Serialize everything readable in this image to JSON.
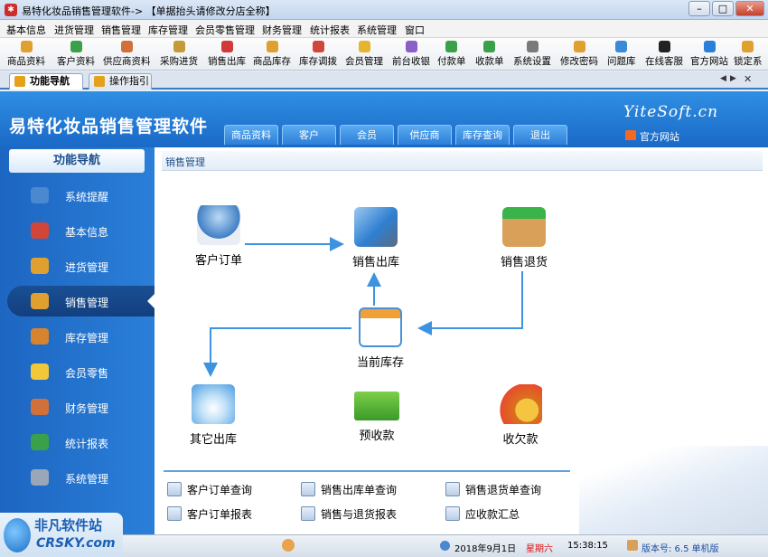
{
  "window": {
    "title": "易特化妆品销售管理软件-> 【单据抬头请修改分店全称】",
    "controls": {
      "minimize": "–",
      "maximize": "□",
      "close": "✕"
    }
  },
  "menu": [
    "基本信息",
    "进货管理",
    "销售管理",
    "库存管理",
    "会员零售管理",
    "财务管理",
    "统计报表",
    "系统管理",
    "窗口"
  ],
  "toolbar": [
    {
      "label": "商品资料",
      "icon": "goods-icon",
      "color": "#e0a030"
    },
    {
      "label": "客户资料",
      "icon": "customer-icon",
      "color": "#3aa14a"
    },
    {
      "label": "供应商资料",
      "icon": "supplier-icon",
      "color": "#d2703a"
    },
    {
      "label": "采购进货",
      "icon": "purchase-icon",
      "color": "#c59b3a"
    },
    {
      "label": "销售出库",
      "icon": "sales-out-icon",
      "color": "#d23a3a"
    },
    {
      "label": "商品库存",
      "icon": "inventory-icon",
      "color": "#e0a030"
    },
    {
      "label": "库存调拨",
      "icon": "transfer-icon",
      "color": "#d0463a"
    },
    {
      "label": "会员管理",
      "icon": "member-icon",
      "color": "#e6b530"
    },
    {
      "label": "前台收银",
      "icon": "cashier-icon",
      "color": "#8a5fc8"
    },
    {
      "label": "付款单",
      "icon": "payment-icon",
      "color": "#3aa14a"
    },
    {
      "label": "收款单",
      "icon": "receipt-icon",
      "color": "#3aa14a"
    },
    {
      "label": "系统设置",
      "icon": "settings-icon",
      "color": "#7a7a7a"
    },
    {
      "label": "修改密码",
      "icon": "password-icon",
      "color": "#e0a030"
    },
    {
      "label": "问题库",
      "icon": "faq-icon",
      "color": "#3a8ad8"
    },
    {
      "label": "在线客服",
      "icon": "support-icon",
      "color": "#222222"
    },
    {
      "label": "官方网站",
      "icon": "browser-icon",
      "color": "#2a7fd8"
    },
    {
      "label": "锁定系",
      "icon": "lock-icon",
      "color": "#e0a030"
    }
  ],
  "tabs": [
    {
      "label": "功能导航"
    },
    {
      "label": "操作指引"
    }
  ],
  "banner": {
    "title": "易特化妆品销售管理软件",
    "brand": "YiteSoft.cn",
    "site": "官方网站",
    "tabs": [
      "商品资料",
      "客户",
      "会员",
      "供应商",
      "库存查询",
      "退出"
    ]
  },
  "sidebar": {
    "header": "功能导航",
    "items": [
      {
        "label": "系统提醒",
        "color": "#4a88d0"
      },
      {
        "label": "基本信息",
        "color": "#d2463a"
      },
      {
        "label": "进货管理",
        "color": "#e0a030"
      },
      {
        "label": "销售管理",
        "color": "#e0a030"
      },
      {
        "label": "库存管理",
        "color": "#d8832e"
      },
      {
        "label": "会员零售",
        "color": "#f0c838"
      },
      {
        "label": "财务管理",
        "color": "#d2703a"
      },
      {
        "label": "统计报表",
        "color": "#3aa14a"
      },
      {
        "label": "系统管理",
        "color": "#9aa7b8"
      }
    ],
    "active_index": 3
  },
  "content": {
    "section_title": "销售管理",
    "nodes": {
      "order": "客户订单",
      "sales_out": "销售出库",
      "sales_return": "销售退货",
      "stock": "当前库存",
      "other_out": "其它出库",
      "advance": "预收款",
      "debt": "收欠款"
    },
    "reports": [
      "客户订单查询",
      "销售出库单查询",
      "销售退货单查询",
      "客户订单报表",
      "销售与退货报表",
      "应收款汇总"
    ]
  },
  "status": {
    "date": "2018年9月1日",
    "weekday": "星期六",
    "time": "15:38:15",
    "version": "版本号: 6.5  单机版"
  },
  "watermark": {
    "cn": "非凡软件站",
    "en": "CRSKY.com"
  }
}
